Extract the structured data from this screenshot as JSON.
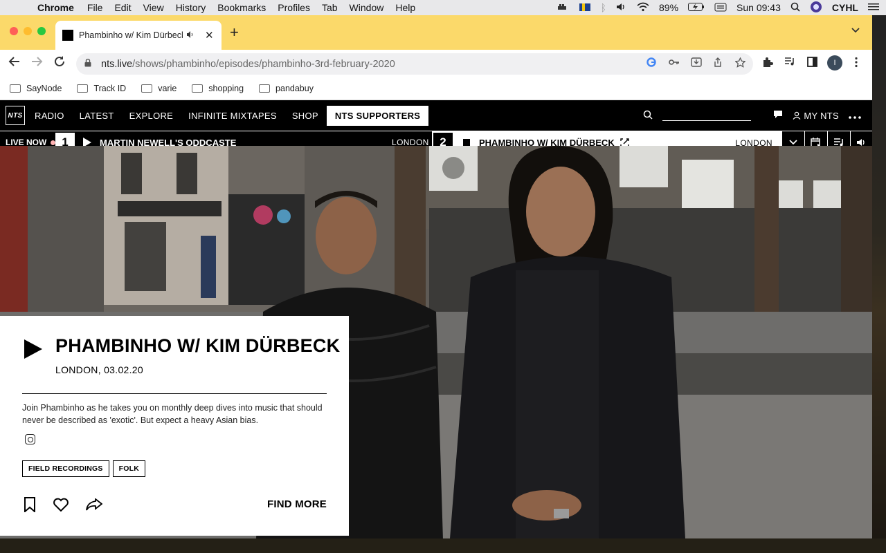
{
  "menubar": {
    "app": "Chrome",
    "items": [
      "File",
      "Edit",
      "View",
      "History",
      "Bookmarks",
      "Profiles",
      "Tab",
      "Window",
      "Help"
    ],
    "battery": "89%",
    "clock": "Sun 09:43",
    "user": "CYHL"
  },
  "browser": {
    "tab_title": "Phambinho w/ Kim Dürbeck",
    "url_host": "nts.live",
    "url_path": "/shows/phambinho/episodes/phambinho-3rd-february-2020",
    "profile_initial": "I"
  },
  "bookmarks": [
    "SayNode",
    "Track ID",
    "varie",
    "shopping",
    "pandabuy"
  ],
  "nts_nav": {
    "logo": "NTS",
    "links": [
      "RADIO",
      "LATEST",
      "EXPLORE",
      "INFINITE MIXTAPES",
      "SHOP"
    ],
    "supporters": "NTS SUPPORTERS",
    "my_nts": "MY NTS"
  },
  "live_bar": {
    "label": "LIVE NOW",
    "channel1": {
      "number": "1",
      "title": "MARTIN NEWELL'S ODDCASTE",
      "location": "LONDON"
    },
    "channel2": {
      "number": "2",
      "title": "PHAMBINHO W/ KIM DÜRBECK",
      "location": "LONDON"
    }
  },
  "episode": {
    "title": "PHAMBINHO W/ KIM DÜRBECK",
    "meta": "LONDON, 03.02.20",
    "description": "Join Phambinho as he takes you on monthly deep dives into music that should never be described as 'exotic'. But expect a heavy Asian bias.",
    "tags": [
      "FIELD RECORDINGS",
      "FOLK"
    ],
    "find_more": "FIND MORE"
  }
}
